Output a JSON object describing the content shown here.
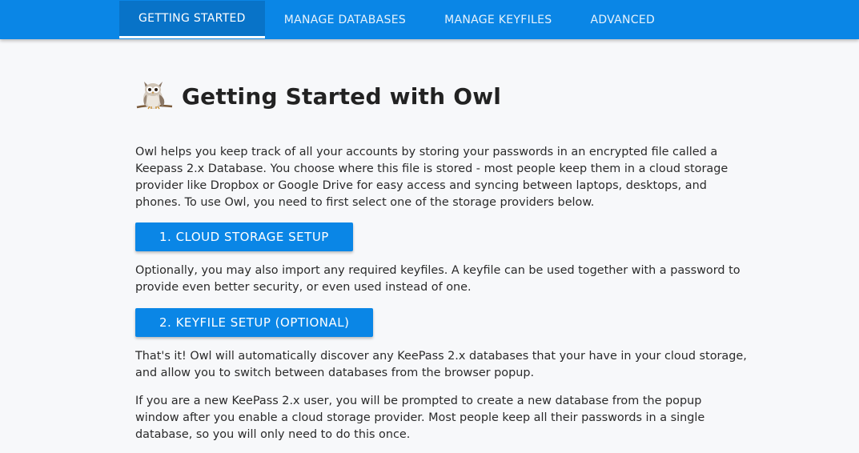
{
  "nav": {
    "tabs": [
      {
        "label": "GETTING STARTED",
        "active": true
      },
      {
        "label": "MANAGE DATABASES",
        "active": false
      },
      {
        "label": "MANAGE KEYFILES",
        "active": false
      },
      {
        "label": "ADVANCED",
        "active": false
      }
    ],
    "color": "#0a86e6"
  },
  "main": {
    "title": "Getting Started with Owl",
    "logo_icon": "owl-icon",
    "intro": "Owl helps you keep track of all your accounts by storing your passwords in an encrypted file called a Keepass 2.x Database. You choose where this file is stored - most people keep them in a cloud storage provider like Dropbox or Google Drive for easy access and syncing between laptops, desktops, and phones. To use Owl, you need to first select one of the storage providers below.",
    "cloud_button": "1. CLOUD STORAGE SETUP",
    "keyfile_text": "Optionally, you may also import any required keyfiles. A keyfile can be used together with a password to provide even better security, or even used instead of one.",
    "keyfile_button": "2. KEYFILE SETUP (OPTIONAL)",
    "discover_text": "That's it! Owl will automatically discover any KeePass 2.x databases that your have in your cloud storage, and allow you to switch between databases from the browser popup.",
    "new_user_text": "If you are a new KeePass 2.x user, you will be prompted to create a new database from the popup window after you enable a cloud storage provider. Most people keep all their passwords in a single database, so you will only need to do this once."
  }
}
